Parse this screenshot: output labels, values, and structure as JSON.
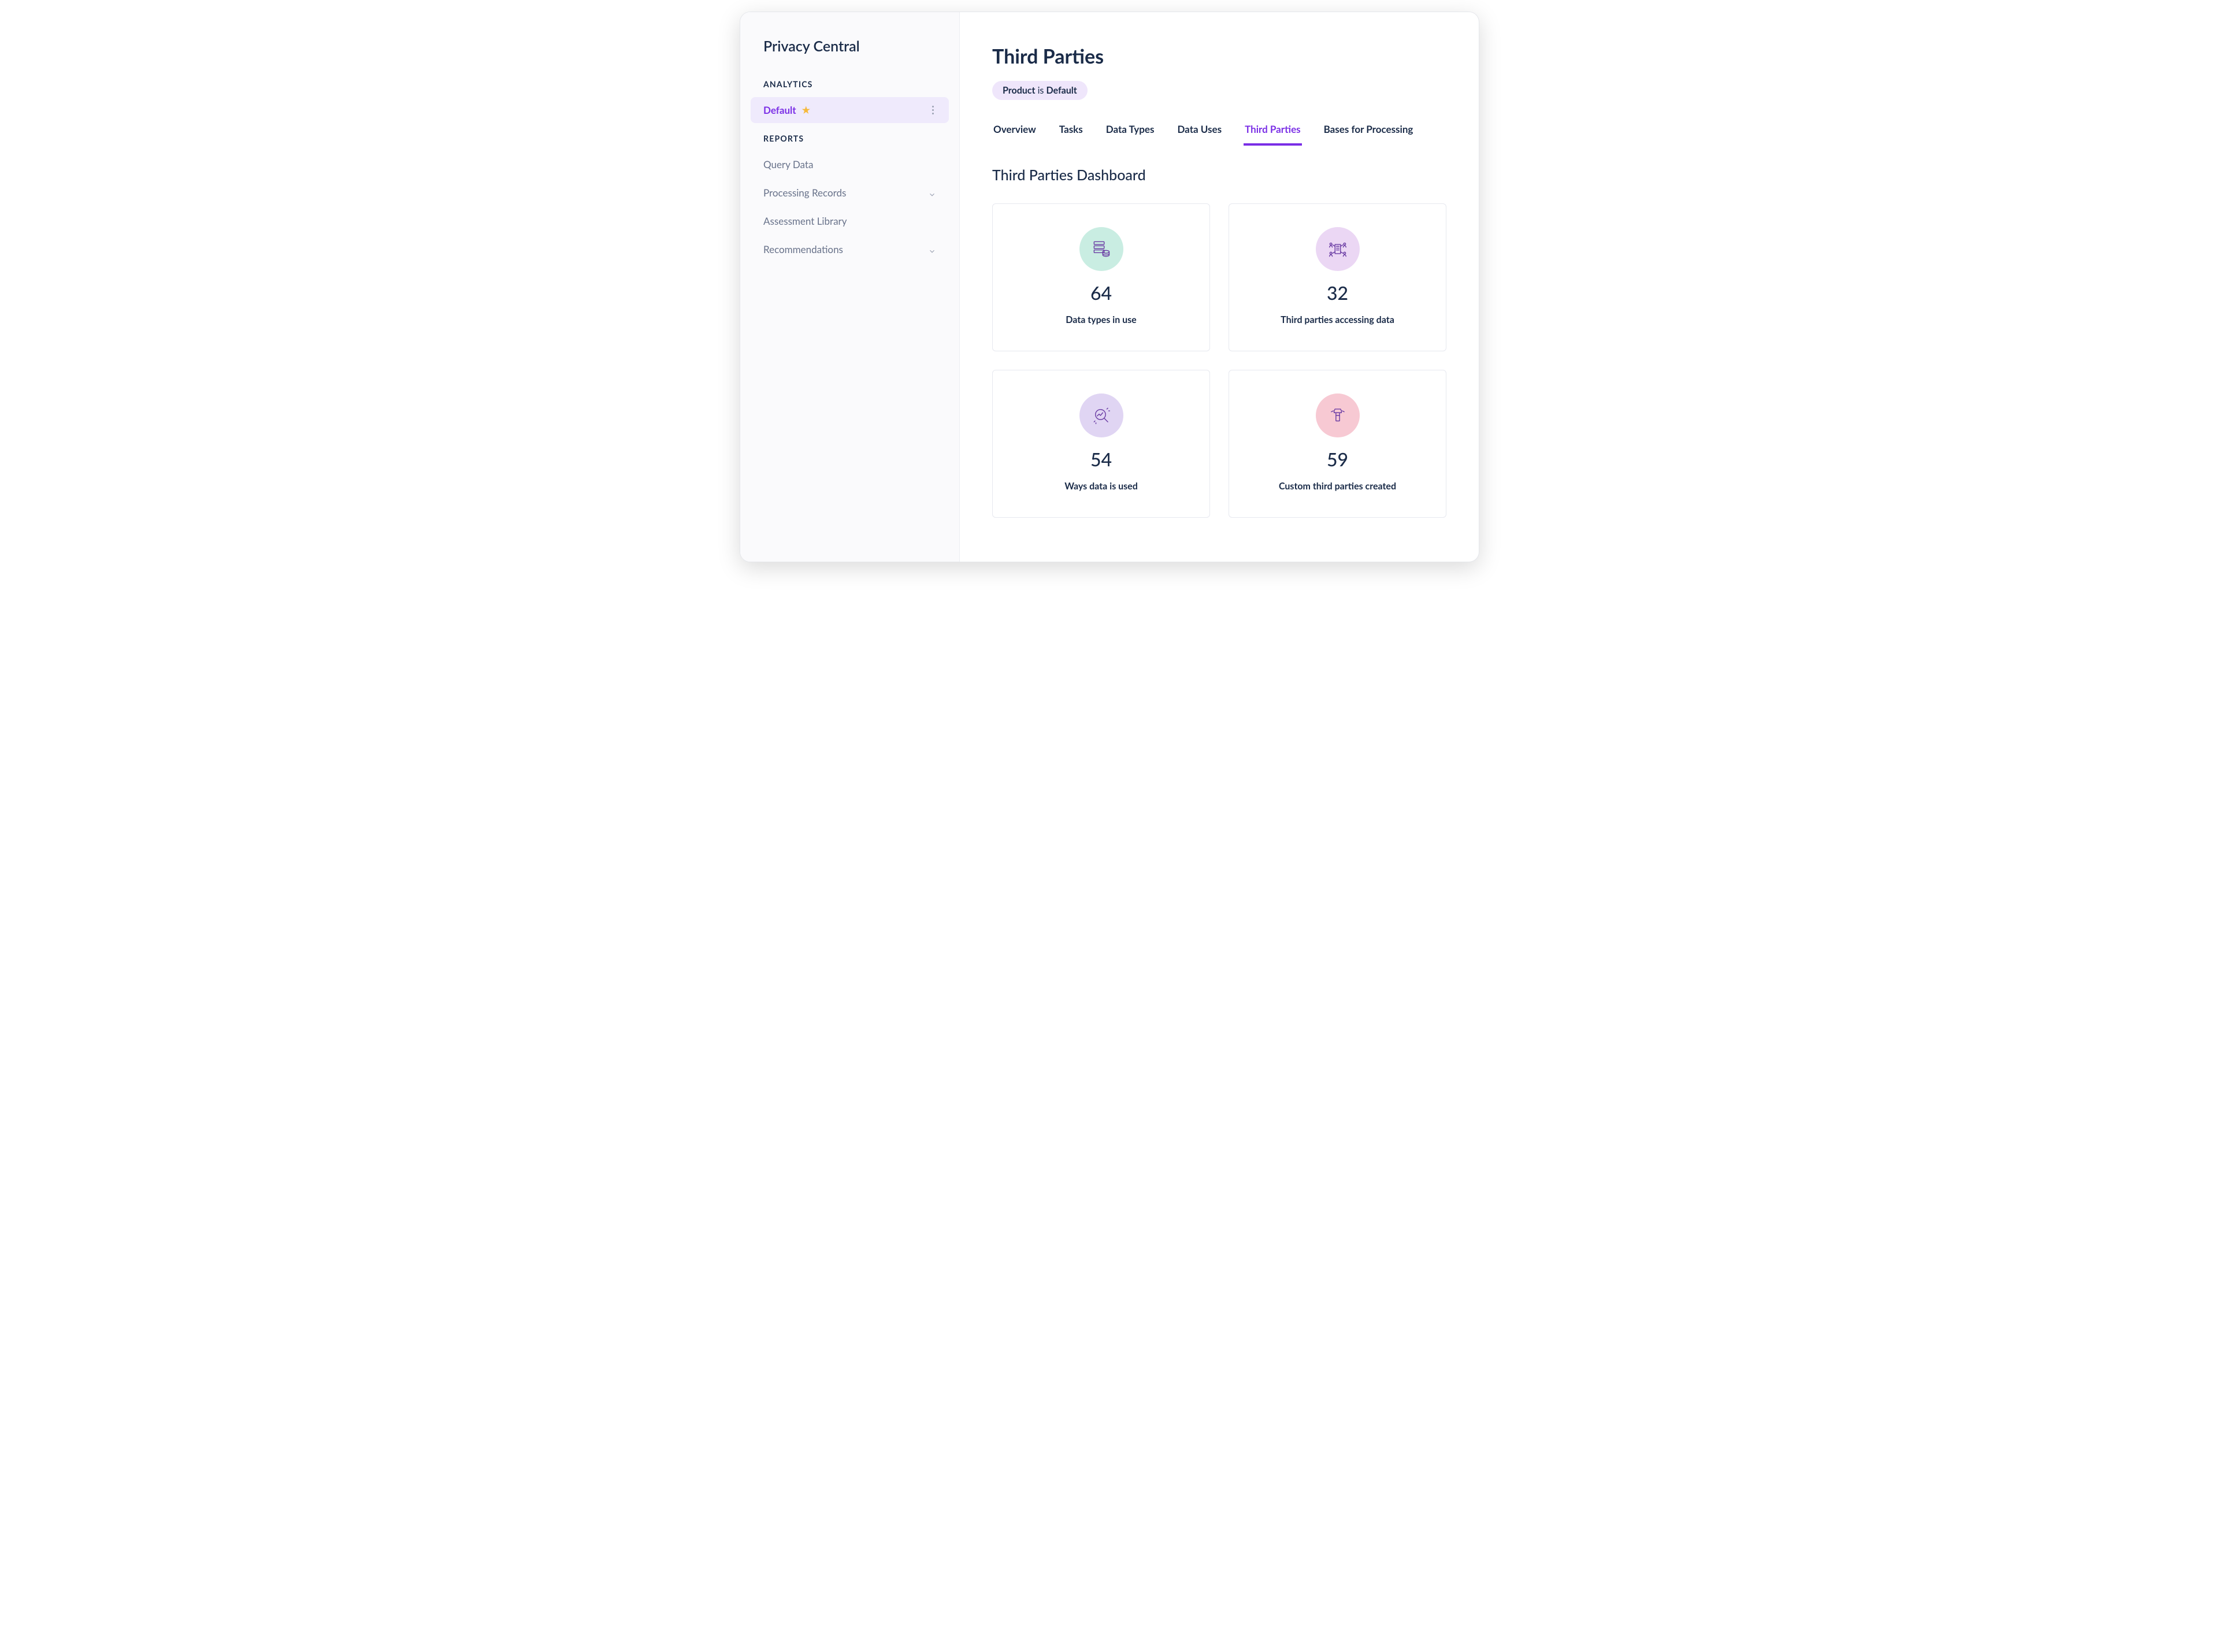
{
  "app_title": "Privacy Central",
  "sidebar": {
    "sections": [
      {
        "header": "Analytics",
        "items": [
          {
            "label": "Default",
            "starred": true,
            "active": true,
            "kebab": true
          }
        ]
      },
      {
        "header": "Reports",
        "items": [
          {
            "label": "Query Data"
          },
          {
            "label": "Processing Records",
            "expandable": true
          },
          {
            "label": "Assessment Library"
          },
          {
            "label": "Recommendations",
            "expandable": true
          }
        ]
      }
    ]
  },
  "main": {
    "title": "Third Parties",
    "chip": {
      "key": "Product",
      "join": " is ",
      "value": "Default"
    },
    "tabs": [
      {
        "label": "Overview"
      },
      {
        "label": "Tasks"
      },
      {
        "label": "Data Types"
      },
      {
        "label": "Data Uses"
      },
      {
        "label": "Third Parties",
        "active": true
      },
      {
        "label": "Bases for Processing"
      }
    ],
    "section_title": "Third Parties Dashboard",
    "cards": [
      {
        "value": "64",
        "label": "Data types in use",
        "icon": "database-stack-icon",
        "color": "teal"
      },
      {
        "value": "32",
        "label": "Third parties accessing data",
        "icon": "org-network-icon",
        "color": "lilac"
      },
      {
        "value": "54",
        "label": "Ways data is used",
        "icon": "magnify-analytics-icon",
        "color": "violet"
      },
      {
        "value": "59",
        "label": "Custom third parties created",
        "icon": "build-tool-icon",
        "color": "pink"
      }
    ]
  }
}
